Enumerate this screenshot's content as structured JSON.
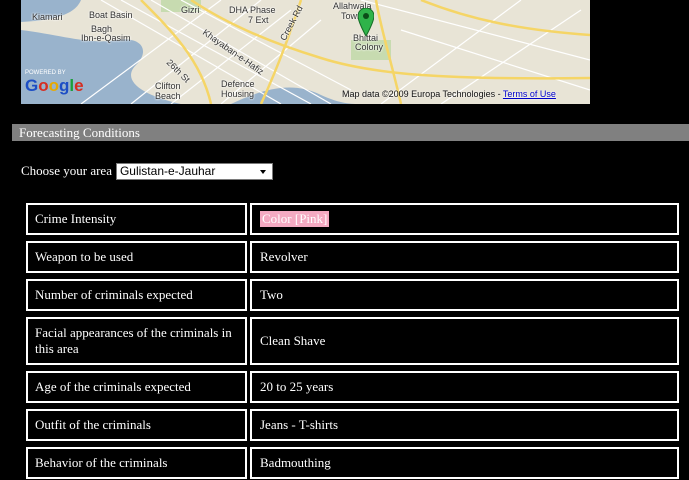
{
  "map": {
    "labels": {
      "kiamari": "Kiamari",
      "boat_basin": "Boat Basin",
      "gizri": "Gizri",
      "dha_phase": "DHA Phase",
      "seven_ext": "7 Ext",
      "allahwala": "Allahwala",
      "town": "Town",
      "bagh": "Bagh",
      "ibn_e_qasim": "Ibn-e-Qasim",
      "bhittai": "Bhittai",
      "colony": "Colony",
      "clifton": "Clifton",
      "beach": "Beach",
      "defence": "Defence",
      "housing": "Housing",
      "creek_rd": "Creek Rd",
      "26th_st": "26th St",
      "khayaban_e_hafiz": "Khayaban-e-Hafiz"
    },
    "powered_by": "POWERED BY",
    "logo": [
      "G",
      "o",
      "o",
      "g",
      "l",
      "e"
    ],
    "attribution": "Map data ©2009 Europa Technologies -",
    "terms_link": "Terms of Use"
  },
  "section": {
    "title": "Forecasting Conditions"
  },
  "area": {
    "label": "Choose your area",
    "selected": "Gulistan-e-Jauhar"
  },
  "conditions": [
    {
      "label": "Crime Intensity",
      "value": "Color [Pink]",
      "value_highlight": "#f4aac2"
    },
    {
      "label": "Weapon to be used",
      "value": "Revolver"
    },
    {
      "label": "Number of criminals expected",
      "value": "Two"
    },
    {
      "label": "Facial appearances of  the criminals in this area",
      "value": "Clean Shave"
    },
    {
      "label": "Age of the criminals expected",
      "value": "20 to 25 years"
    },
    {
      "label": "Outfit of the criminals",
      "value": "Jeans - T-shirts"
    },
    {
      "label": "Behavior of the criminals",
      "value": "Badmouthing"
    }
  ]
}
